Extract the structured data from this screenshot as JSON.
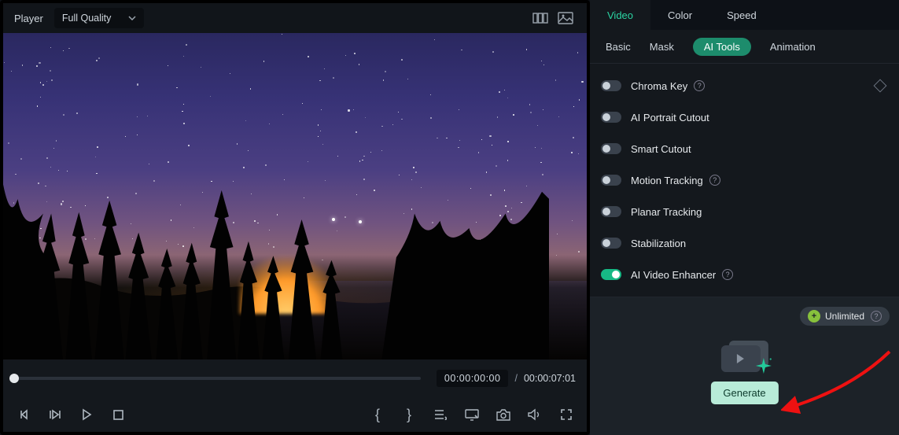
{
  "player": {
    "label": "Player",
    "quality": "Full Quality",
    "time_current": "00:00:00:00",
    "time_total": "00:00:07:01"
  },
  "inspector": {
    "tabs": [
      "Video",
      "Color",
      "Speed"
    ],
    "active_tab": "Video",
    "sub_tabs": [
      "Basic",
      "Mask",
      "AI Tools",
      "Animation"
    ],
    "active_sub_tab": "AI Tools",
    "options": [
      {
        "label": "Chroma Key",
        "on": false,
        "help": true,
        "diamond": true
      },
      {
        "label": "AI Portrait Cutout",
        "on": false,
        "help": false,
        "diamond": false
      },
      {
        "label": "Smart Cutout",
        "on": false,
        "help": false,
        "diamond": false
      },
      {
        "label": "Motion Tracking",
        "on": false,
        "help": true,
        "diamond": false
      },
      {
        "label": "Planar Tracking",
        "on": false,
        "help": false,
        "diamond": false
      },
      {
        "label": "Stabilization",
        "on": false,
        "help": false,
        "diamond": false
      },
      {
        "label": "AI Video Enhancer",
        "on": true,
        "help": true,
        "diamond": false
      }
    ],
    "unlimited_label": "Unlimited",
    "generate_label": "Generate"
  }
}
